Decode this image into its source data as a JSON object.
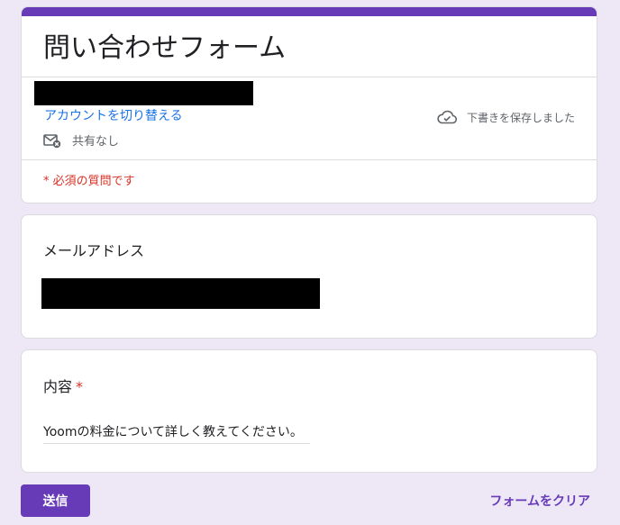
{
  "form": {
    "title": "問い合わせフォーム",
    "switch_account_label": "アカウントを切り替える",
    "share_status": "共有なし",
    "draft_status": "下書きを保存しました",
    "required_note": "* 必須の質問です"
  },
  "questions": [
    {
      "title": "メールアドレス",
      "required": false
    },
    {
      "title": "内容",
      "required": true,
      "required_mark": "*",
      "answer": "Yoomの料金について詳しく教えてください。"
    }
  ],
  "actions": {
    "submit_label": "送信",
    "clear_label": "フォームをクリア"
  },
  "colors": {
    "accent": "#673ab7",
    "background": "#ede7f6",
    "link": "#1a73e8",
    "required": "#d93025"
  },
  "icons": {
    "share": "mail-blocked-icon",
    "draft": "cloud-check-icon"
  }
}
